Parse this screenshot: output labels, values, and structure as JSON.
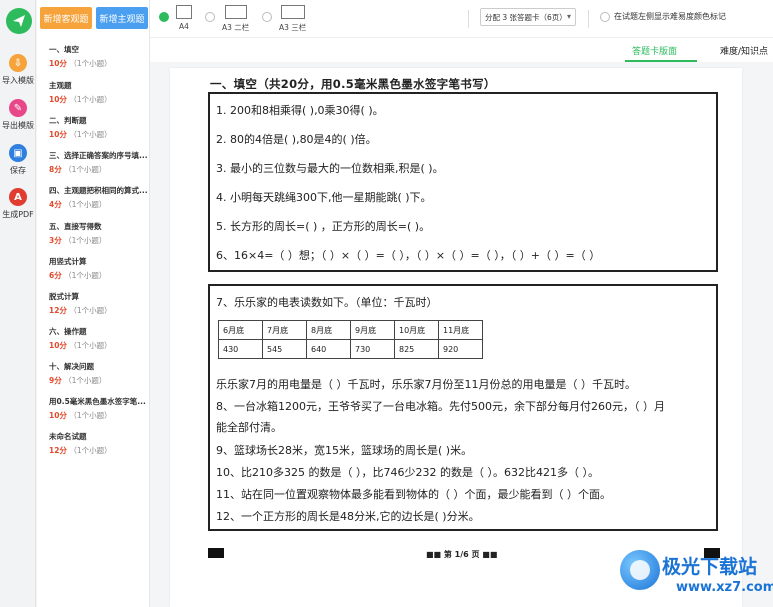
{
  "rail": {
    "items": [
      {
        "label": "导入模版",
        "color": "#f5a33a"
      },
      {
        "label": "导出模版",
        "color": "#e8478a"
      },
      {
        "label": "保存",
        "color": "#2f7fe0"
      },
      {
        "label": "生成PDF",
        "color": "#e03c31"
      }
    ]
  },
  "top_buttons": {
    "add_objective": "新增客观题",
    "add_subjective": "新增主观题"
  },
  "questions": [
    {
      "title": "一、填空",
      "points": "10分",
      "sub": "（1个小题）"
    },
    {
      "title": "主观题",
      "points": "10分",
      "sub": "（1个小题）"
    },
    {
      "title": "二、判断题",
      "points": "10分",
      "sub": "（1个小题）"
    },
    {
      "title": "三、选择正确答案的序号填...",
      "points": "8分",
      "sub": "（1个小题）"
    },
    {
      "title": "四、主观题把积相同的算式...",
      "points": "4分",
      "sub": "（1个小题）"
    },
    {
      "title": "五、直接写得数",
      "points": "3分",
      "sub": "（1个小题）"
    },
    {
      "title": "用竖式计算",
      "points": "6分",
      "sub": "（1个小题）"
    },
    {
      "title": "脱式计算",
      "points": "12分",
      "sub": "（1个小题）"
    },
    {
      "title": "六、操作题",
      "points": "10分",
      "sub": "（1个小题）"
    },
    {
      "title": "十、解决问题",
      "points": "9分",
      "sub": "（1个小题）"
    },
    {
      "title": "用0.5毫米黑色墨水签字笔...",
      "points": "10分",
      "sub": "（1个小题）"
    },
    {
      "title": "未命名试题",
      "points": "12分",
      "sub": "（1个小题）"
    }
  ],
  "toolbar": {
    "paper_options": [
      "A4",
      "A3 二栏",
      "A3 三栏"
    ],
    "selected_paper": "A4",
    "card_select": "分配 3 张答题卡（6页）",
    "hint_checkbox": "在试题左侧显示难易度颜色标记"
  },
  "tabs": [
    "答题卡版面",
    "难度/知识点"
  ],
  "active_tab": "答题卡版面",
  "document": {
    "section_title": "一、填空（共20分，用0.5毫米黑色墨水签字笔书写）",
    "box1_lines": [
      "1. 200和8相乘得(      ),0乘30得(      )。",
      "2. 80的4倍是(      ),80是4的(      )倍。",
      "3. 最小的三位数与最大的一位数相乘,积是(      )。",
      "4. 小明每天跳绳300下,他一星期能跳(      )下。",
      "5. 长方形的周长=(                ) ，正方形的周长=(              )。",
      "6、16×4=（ ）想；（ ）×（ ）=（ ），（ ）×（ ）=（ ），（ ）+（ ）=（ ）"
    ],
    "q7_title": "7、乐乐家的电表读数如下。（单位：千瓦时）",
    "meter_months": [
      "6月底",
      "7月底",
      "8月底",
      "9月底",
      "10月底",
      "11月底"
    ],
    "meter_values": [
      "430",
      "545",
      "640",
      "730",
      "825",
      "920"
    ],
    "box2_lines": [
      "乐乐家7月的用电量是（    ）千瓦时，乐乐家7月份至11月份总的用电量是（      ）千瓦时。",
      "8、一台冰箱1200元，王爷爷买了一台电冰箱。先付500元，余下部分每月付260元，（   ）月",
      "能全部付清。",
      "9、篮球场长28米，宽15米，篮球场的周长是(      )米。",
      "10、比210多325 的数是（    ），比746少232 的数是（   ）。632比421多（   ）。",
      "11、站在同一位置观察物体最多能看到物体的（   ）个面，最少能看到（   ）个面。",
      "12、一个正方形的周长是48分米,它的边长是(     )分米。"
    ],
    "page_number": "■■ 第 1/6 页 ■■"
  },
  "watermark": {
    "name": "极光下载站",
    "url": "www.xz7.com"
  },
  "colors": {
    "accent": "#2dbb5d",
    "points": "#e04b2e",
    "orange": "#f5a33a",
    "blue": "#4b9ff0"
  }
}
